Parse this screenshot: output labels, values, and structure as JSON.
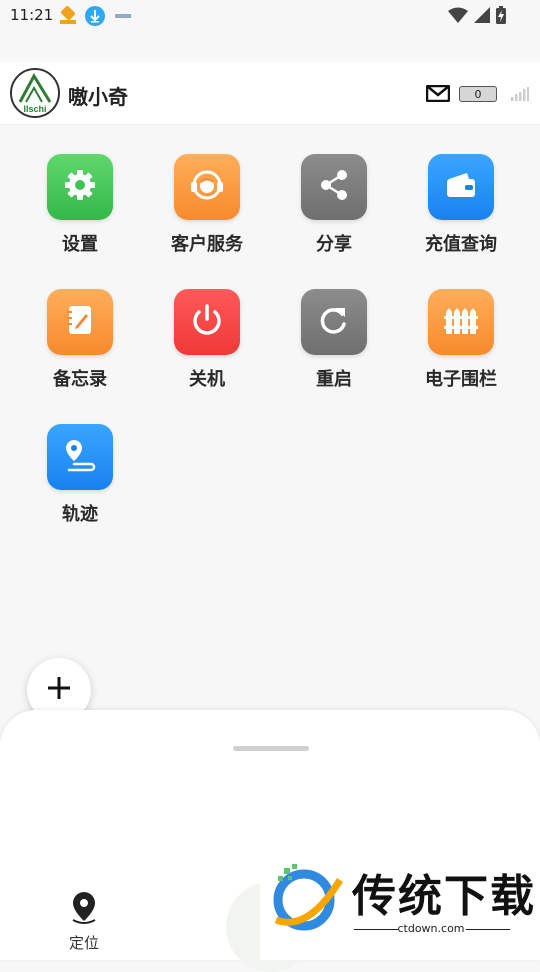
{
  "status_bar": {
    "time": "11:21",
    "icons": [
      "notification-app-icon",
      "download-icon",
      "small-app-icon"
    ],
    "right_icons": [
      "wifi-icon",
      "cell-signal-icon",
      "battery-charging-icon"
    ]
  },
  "header": {
    "avatar_text": "Ilschi",
    "title": "嗷小奇",
    "message_count": "0"
  },
  "menu": [
    {
      "label": "设置",
      "icon": "gear-icon",
      "color": "#3dc453"
    },
    {
      "label": "客户服务",
      "icon": "headset-icon",
      "color": "#f99237"
    },
    {
      "label": "分享",
      "icon": "share-icon",
      "color": "#7c7c7c"
    },
    {
      "label": "充值查询",
      "icon": "wallet-icon",
      "color": "#1f8cf3"
    },
    {
      "label": "备忘录",
      "icon": "notebook-icon",
      "color": "#f99237"
    },
    {
      "label": "关机",
      "icon": "power-icon",
      "color": "#f54444"
    },
    {
      "label": "重启",
      "icon": "restart-icon",
      "color": "#7c7c7c"
    },
    {
      "label": "电子围栏",
      "icon": "fence-icon",
      "color": "#f99237"
    },
    {
      "label": "轨迹",
      "icon": "route-icon",
      "color": "#1f8cf3"
    }
  ],
  "bottom_sheet": {
    "location_label": "定位"
  },
  "watermark": {
    "text": "传统下载",
    "url": "ctdown.com"
  }
}
